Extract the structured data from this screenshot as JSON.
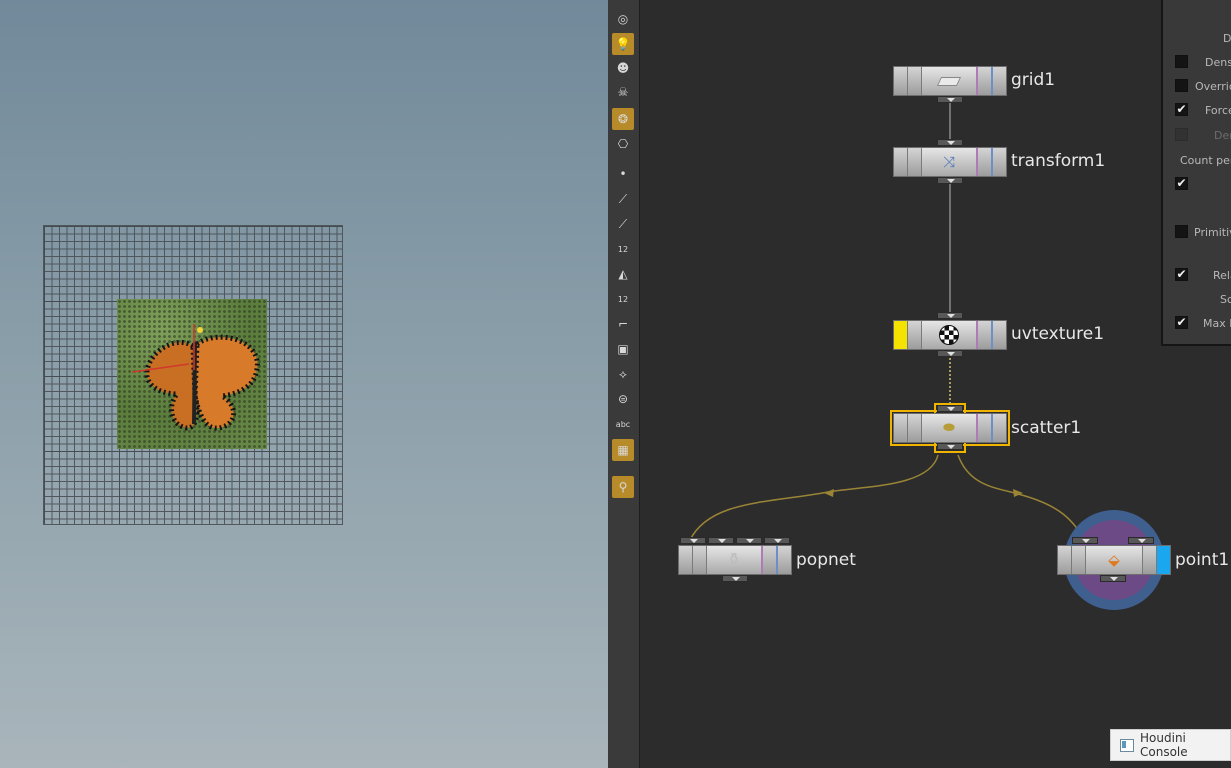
{
  "toolbar": {
    "tools": [
      {
        "icon": "sphere-icon",
        "glyph": "◎"
      },
      {
        "icon": "light-icon",
        "glyph": "💡",
        "active": true
      },
      {
        "icon": "light-dot-icon",
        "glyph": "☻"
      },
      {
        "icon": "skull-light-icon",
        "glyph": "☠"
      },
      {
        "icon": "shade-icon",
        "glyph": "❂",
        "active": true
      },
      {
        "icon": "camera-icon",
        "glyph": "⎔"
      },
      {
        "icon": "point-icon",
        "glyph": "•"
      },
      {
        "icon": "brush-icon",
        "glyph": "⟋"
      },
      {
        "icon": "pen-icon",
        "glyph": "⟋"
      },
      {
        "icon": "point-number-icon",
        "glyph": "12"
      },
      {
        "icon": "prim-icon",
        "glyph": "◭"
      },
      {
        "icon": "prim-number-icon",
        "glyph": "12"
      },
      {
        "icon": "edge-icon",
        "glyph": "⌐"
      },
      {
        "icon": "select-box-icon",
        "glyph": "▣"
      },
      {
        "icon": "normal-icon",
        "glyph": "⟡"
      },
      {
        "icon": "uv-icon",
        "glyph": "⊜"
      },
      {
        "icon": "text-icon",
        "glyph": "abc"
      },
      {
        "icon": "image-icon",
        "glyph": "▦",
        "active": true
      },
      {
        "icon": "pin-icon",
        "glyph": "⚲",
        "active": true
      }
    ]
  },
  "network": {
    "nodes": [
      {
        "name": "grid1"
      },
      {
        "name": "transform1"
      },
      {
        "name": "uvtexture1"
      },
      {
        "name": "scatter1",
        "selected": true
      },
      {
        "name": "popnet"
      },
      {
        "name": "point1",
        "display": true
      }
    ],
    "colors": {
      "wire": "#9a8536",
      "selected": "#f0b400",
      "display_flag": "#1aa7f0",
      "template_flag": "#f4e300"
    }
  },
  "params": {
    "rows": [
      {
        "label": "D",
        "checkbox": null
      },
      {
        "label": "Dens",
        "checkbox": false
      },
      {
        "label": "Overric",
        "checkbox": false
      },
      {
        "label": "Force",
        "checkbox": true
      },
      {
        "label": "Den",
        "checkbox": "dim"
      },
      {
        "label": "Count per",
        "checkbox": null
      },
      {
        "label": "",
        "checkbox": true
      },
      {
        "label": "Primitiv",
        "checkbox": false
      },
      {
        "label": "Rela",
        "checkbox": true
      },
      {
        "label": "Sc",
        "checkbox": null
      },
      {
        "label": "Max F",
        "checkbox": true
      }
    ]
  },
  "console": {
    "title": "Houdini Console"
  }
}
